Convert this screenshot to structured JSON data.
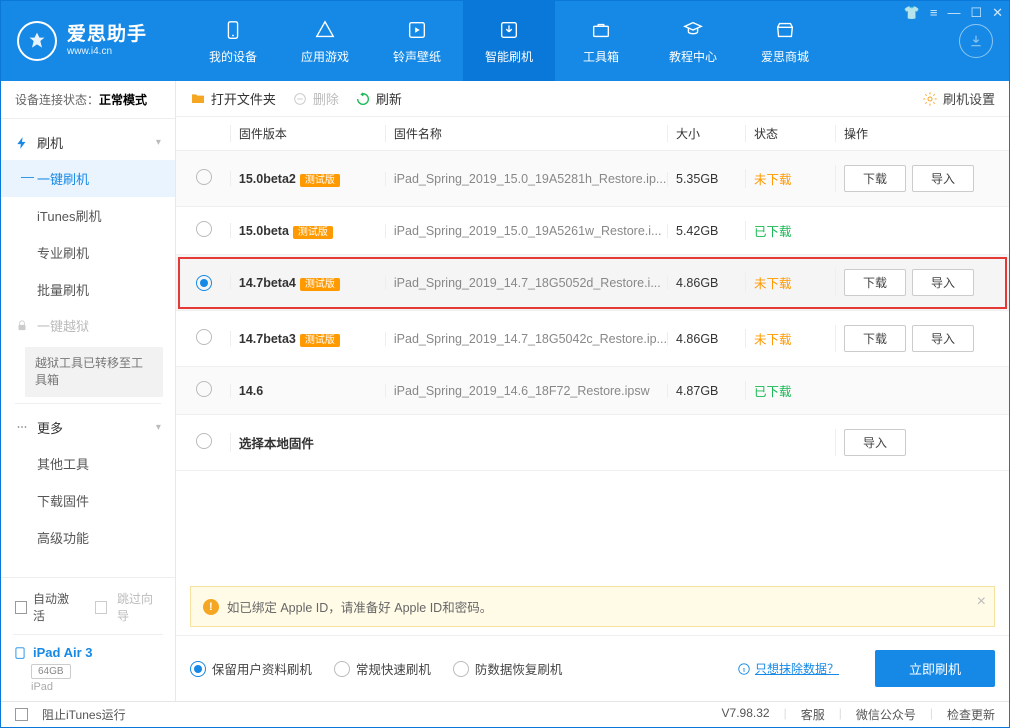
{
  "brand": {
    "name": "爱思助手",
    "url": "www.i4.cn"
  },
  "nav": {
    "items": [
      {
        "label": "我的设备"
      },
      {
        "label": "应用游戏"
      },
      {
        "label": "铃声壁纸"
      },
      {
        "label": "智能刷机"
      },
      {
        "label": "工具箱"
      },
      {
        "label": "教程中心"
      },
      {
        "label": "爱思商城"
      }
    ]
  },
  "sidebar": {
    "conn_label": "设备连接状态：",
    "conn_value": "正常模式",
    "group_flash": "刷机",
    "items_flash": [
      {
        "label": "一键刷机"
      },
      {
        "label": "iTunes刷机"
      },
      {
        "label": "专业刷机"
      },
      {
        "label": "批量刷机"
      }
    ],
    "group_jailbreak": "一键越狱",
    "jailbreak_note": "越狱工具已转移至工具箱",
    "group_more": "更多",
    "items_more": [
      {
        "label": "其他工具"
      },
      {
        "label": "下载固件"
      },
      {
        "label": "高级功能"
      }
    ]
  },
  "bottomLeft": {
    "auto_activate": "自动激活",
    "skip_guide": "跳过向导",
    "device_name": "iPad Air 3",
    "storage": "64GB",
    "device_type": "iPad"
  },
  "toolbar": {
    "open_folder": "打开文件夹",
    "delete": "删除",
    "refresh": "刷新",
    "settings": "刷机设置"
  },
  "table": {
    "headers": {
      "version": "固件版本",
      "name": "固件名称",
      "size": "大小",
      "status": "状态",
      "action": "操作"
    },
    "rows": [
      {
        "version": "15.0beta2",
        "badge": "测试版",
        "name": "iPad_Spring_2019_15.0_19A5281h_Restore.ip...",
        "size": "5.35GB",
        "status": "未下载",
        "status_class": "orange",
        "actions": [
          "下载",
          "导入"
        ]
      },
      {
        "version": "15.0beta",
        "badge": "测试版",
        "name": "iPad_Spring_2019_15.0_19A5261w_Restore.i...",
        "size": "5.42GB",
        "status": "已下载",
        "status_class": "green",
        "actions": []
      },
      {
        "version": "14.7beta4",
        "badge": "测试版",
        "name": "iPad_Spring_2019_14.7_18G5052d_Restore.i...",
        "size": "4.86GB",
        "status": "未下载",
        "status_class": "orange",
        "actions": [
          "下载",
          "导入"
        ],
        "selected": true
      },
      {
        "version": "14.7beta3",
        "badge": "测试版",
        "name": "iPad_Spring_2019_14.7_18G5042c_Restore.ip...",
        "size": "4.86GB",
        "status": "未下载",
        "status_class": "orange",
        "actions": [
          "下载",
          "导入"
        ]
      },
      {
        "version": "14.6",
        "badge": "",
        "name": "iPad_Spring_2019_14.6_18F72_Restore.ipsw",
        "size": "4.87GB",
        "status": "已下载",
        "status_class": "green",
        "actions": []
      },
      {
        "version": "选择本地固件",
        "badge": "",
        "name": "",
        "size": "",
        "status": "",
        "status_class": "",
        "actions": [
          "导入"
        ],
        "local": true
      }
    ]
  },
  "notice": "如已绑定 Apple ID，请准备好 Apple ID和密码。",
  "options": {
    "keep_data": "保留用户资料刷机",
    "normal": "常规快速刷机",
    "anti_loss": "防数据恢复刷机",
    "erase_link": "只想抹除数据？",
    "flash_now": "立即刷机"
  },
  "statusbar": {
    "block_itunes": "阻止iTunes运行",
    "version": "V7.98.32",
    "service": "客服",
    "wechat": "微信公众号",
    "check_update": "检查更新"
  }
}
